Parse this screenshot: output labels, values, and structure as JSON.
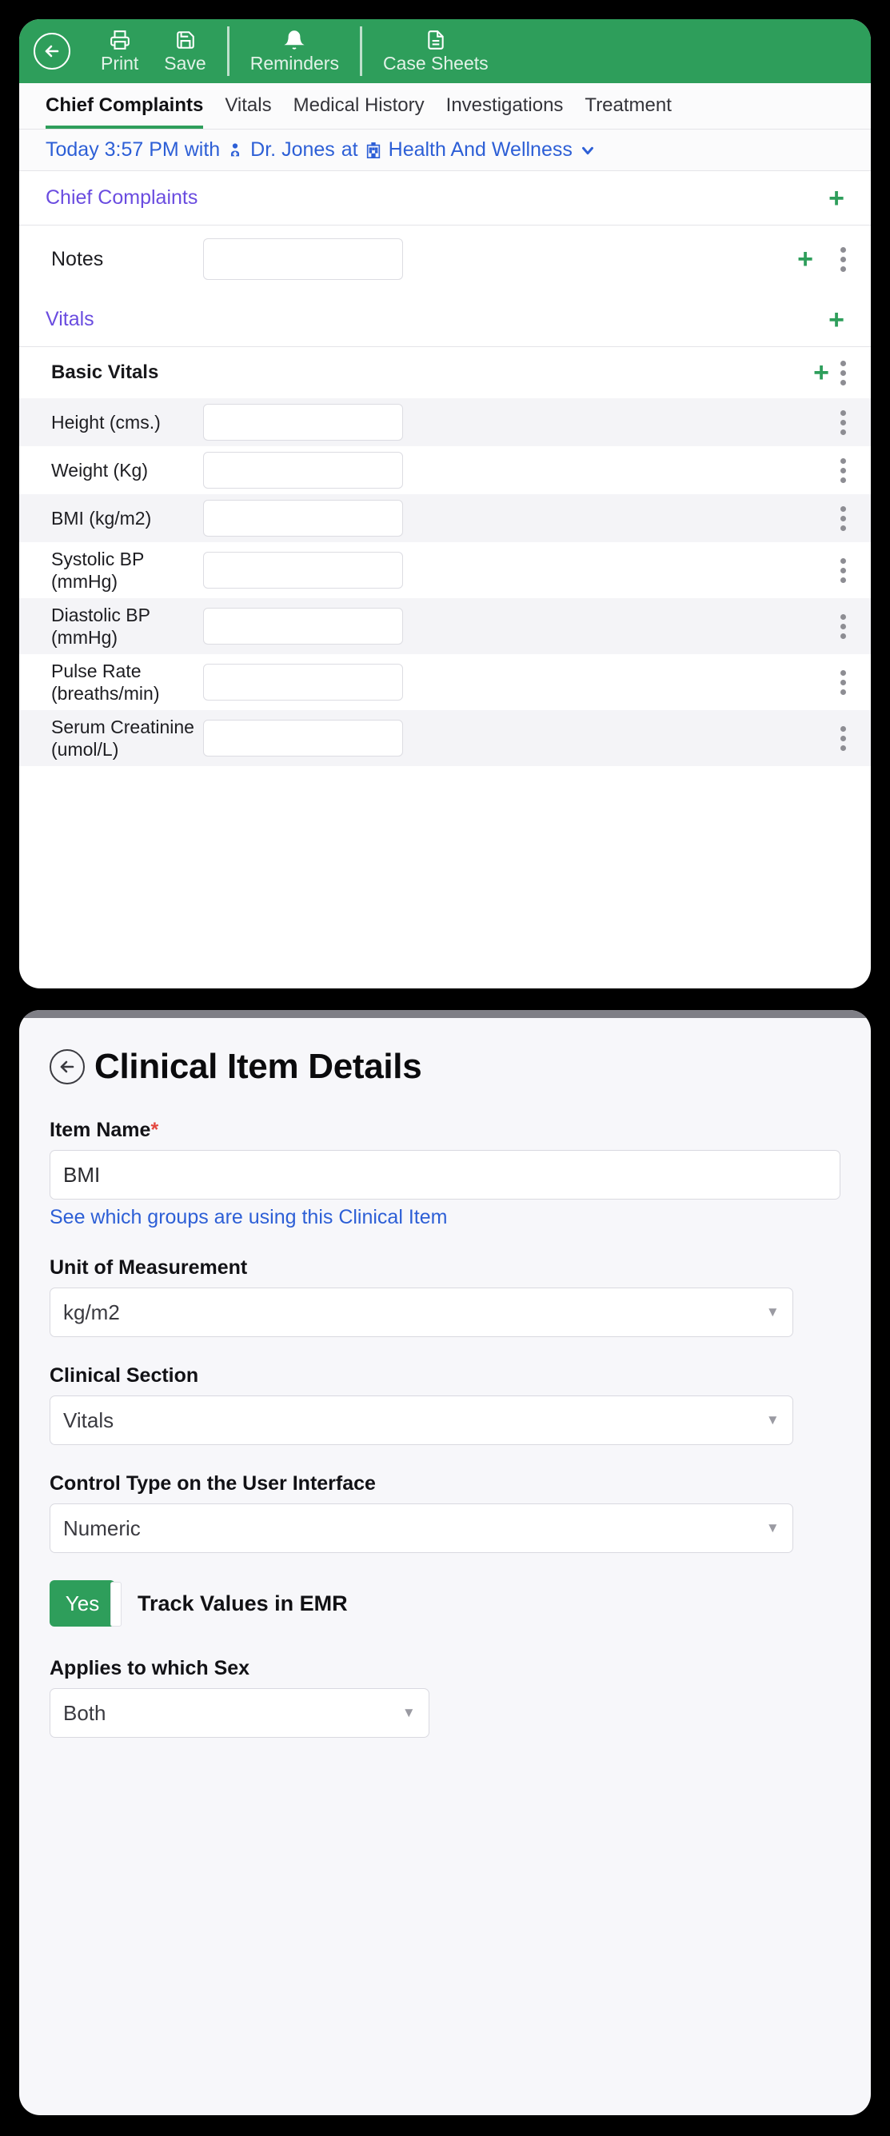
{
  "emr": {
    "toolbar": {
      "back_icon": "back-arrow-circle-icon",
      "items": [
        {
          "label": "Print",
          "icon": "printer-icon"
        },
        {
          "label": "Save",
          "icon": "floppy-disk-icon"
        },
        {
          "label": "Reminders",
          "icon": "bell-icon"
        },
        {
          "label": "Case Sheets",
          "icon": "document-icon"
        }
      ]
    },
    "tabs": [
      {
        "label": "Chief Complaints",
        "active": true
      },
      {
        "label": "Vitals",
        "active": false
      },
      {
        "label": "Medical History",
        "active": false
      },
      {
        "label": "Investigations",
        "active": false
      },
      {
        "label": "Treatment",
        "active": false
      }
    ],
    "appointment": {
      "when": "Today 3:57 PM with",
      "doctor_icon": "doctor-icon",
      "doctor": "Dr. Jones",
      "at": "at",
      "clinic_icon": "hospital-icon",
      "clinic": "Health And Wellness",
      "chevron": "chevron-down-icon"
    },
    "sections": [
      {
        "title": "Chief Complaints"
      },
      {
        "title": "Vitals"
      }
    ],
    "notes_row": {
      "label": "Notes",
      "value": ""
    },
    "group": {
      "title": "Basic Vitals"
    },
    "vitals": [
      {
        "label": "Height (cms.)",
        "value": ""
      },
      {
        "label": "Weight (Kg)",
        "value": ""
      },
      {
        "label": "BMI (kg/m2)",
        "value": ""
      },
      {
        "label": "Systolic BP (mmHg)",
        "value": ""
      },
      {
        "label": "Diastolic BP (mmHg)",
        "value": ""
      },
      {
        "label": "Pulse Rate (breaths/min)",
        "value": ""
      },
      {
        "label": "Serum Creatinine (umol/L)",
        "value": ""
      }
    ],
    "icons": {
      "add": "plus-icon",
      "more": "kebab-menu-icon"
    }
  },
  "detail": {
    "back_icon": "back-arrow-circle-icon",
    "title": "Clinical Item Details",
    "item_name": {
      "label": "Item Name",
      "required_mark": "*",
      "value": "BMI"
    },
    "help_link": "See which groups are using this Clinical Item",
    "unit": {
      "label": "Unit of Measurement",
      "value": "kg/m2"
    },
    "section": {
      "label": "Clinical Section",
      "value": "Vitals"
    },
    "control_type": {
      "label": "Control Type on the User Interface",
      "value": "Numeric"
    },
    "track": {
      "toggle_value": "Yes",
      "label": "Track Values in EMR"
    },
    "sex": {
      "label": "Applies to which Sex",
      "value": "Both"
    },
    "caret_icon": "chevron-down-icon"
  },
  "colors": {
    "header_green": "#2e9e5b",
    "link_blue": "#2d5fd6",
    "section_purple": "#6a4ce0",
    "required_red": "#e3473f"
  }
}
